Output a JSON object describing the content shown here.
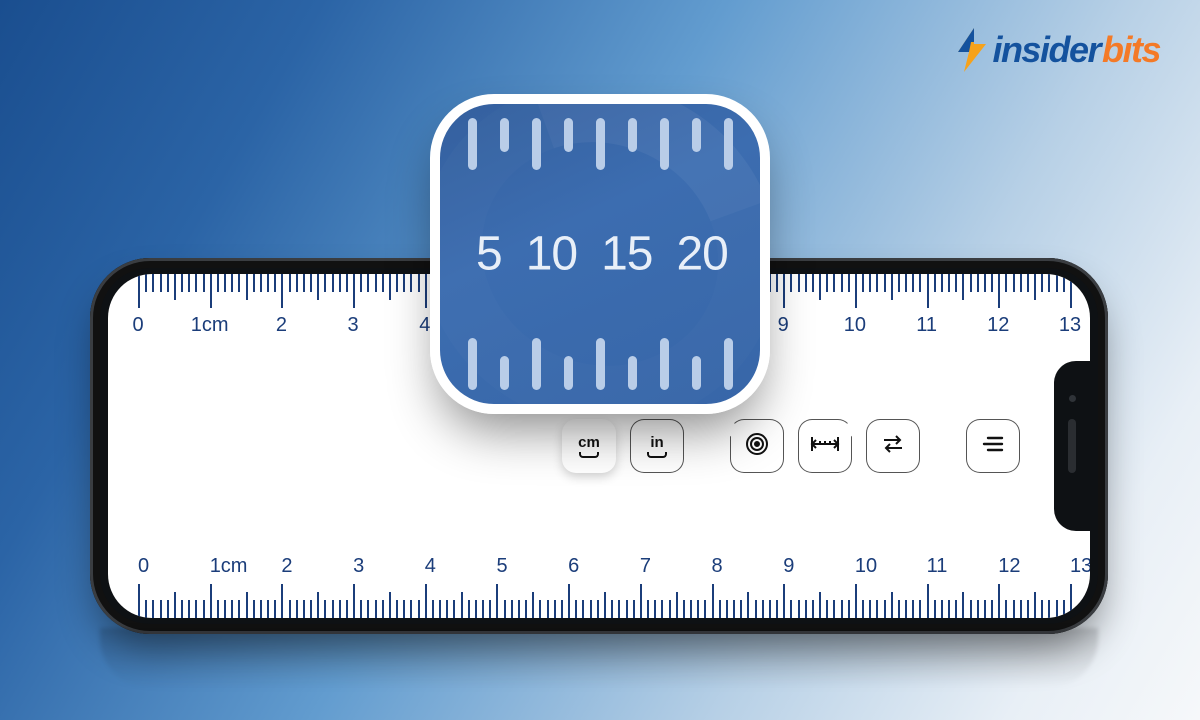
{
  "logo": {
    "part1": "insider",
    "part2": "bits"
  },
  "app_icon": {
    "labels": [
      "5",
      "10",
      "15",
      "20"
    ]
  },
  "ruler": {
    "majors": 14,
    "minors_per_major": 10,
    "labels": [
      "0",
      "1cm",
      "2",
      "3",
      "4",
      "5",
      "6",
      "7",
      "8",
      "9",
      "10",
      "11",
      "12",
      "13"
    ]
  },
  "toolbar": {
    "cm_label": "cm",
    "in_label": "in",
    "calibrate_name": "calibrate",
    "span_name": "span",
    "swap_name": "swap",
    "menu_name": "menu"
  }
}
